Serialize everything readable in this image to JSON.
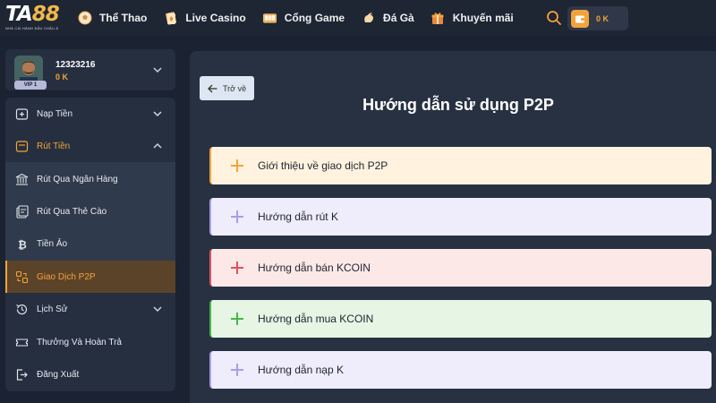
{
  "logo": {
    "main_prefix": "TA",
    "main_suffix": "88",
    "tagline": "NHÀ CÁI HÀNG ĐẦU CHÂU Á"
  },
  "nav": [
    {
      "label": "Thể Thao",
      "icon": "soccer-ball-icon"
    },
    {
      "label": "Live Casino",
      "icon": "cards-icon"
    },
    {
      "label": "Cổng Game",
      "icon": "game-icon"
    },
    {
      "label": "Đá Gà",
      "icon": "rooster-icon"
    },
    {
      "label": "Khuyến mãi",
      "icon": "gift-icon"
    }
  ],
  "wallet": {
    "amount": "0 K",
    "icon": "wallet-icon"
  },
  "user": {
    "id": "12323216",
    "balance": "0 K",
    "vip": "VIP 1"
  },
  "menu": {
    "deposit": "Nạp Tiền",
    "withdraw": "Rút Tiền",
    "withdraw_bank": "Rút Qua Ngân Hàng",
    "withdraw_card": "Rút Qua Thẻ Cào",
    "crypto": "Tiền Ảo",
    "p2p": "Giao Dịch P2P",
    "history": "Lịch Sử",
    "rewards": "Thưởng Và Hoàn Trả",
    "logout": "Đăng Xuất"
  },
  "main": {
    "back_label": "Trở về",
    "title": "Hướng dẫn sử dụng P2P",
    "accordions": [
      {
        "label": "Giới thiệu về giao dịch P2P",
        "bg": "#fff3df",
        "accent": "#f2a33b"
      },
      {
        "label": "Hướng dẫn rút K",
        "bg": "#efedfb",
        "accent": "#a89ee6"
      },
      {
        "label": "Hướng dẫn bán KCOIN",
        "bg": "#fde8e8",
        "accent": "#e0525a"
      },
      {
        "label": "Hướng dẫn mua KCOIN",
        "bg": "#e6f5e4",
        "accent": "#47b54a"
      },
      {
        "label": "Hướng dẫn nạp K",
        "bg": "#efedfb",
        "accent": "#a89ee6"
      }
    ]
  },
  "colors": {
    "accent": "#f2a33b",
    "header_bg": "#1e2533",
    "sidebar_bg": "#262f40",
    "main_bg": "#283142"
  }
}
